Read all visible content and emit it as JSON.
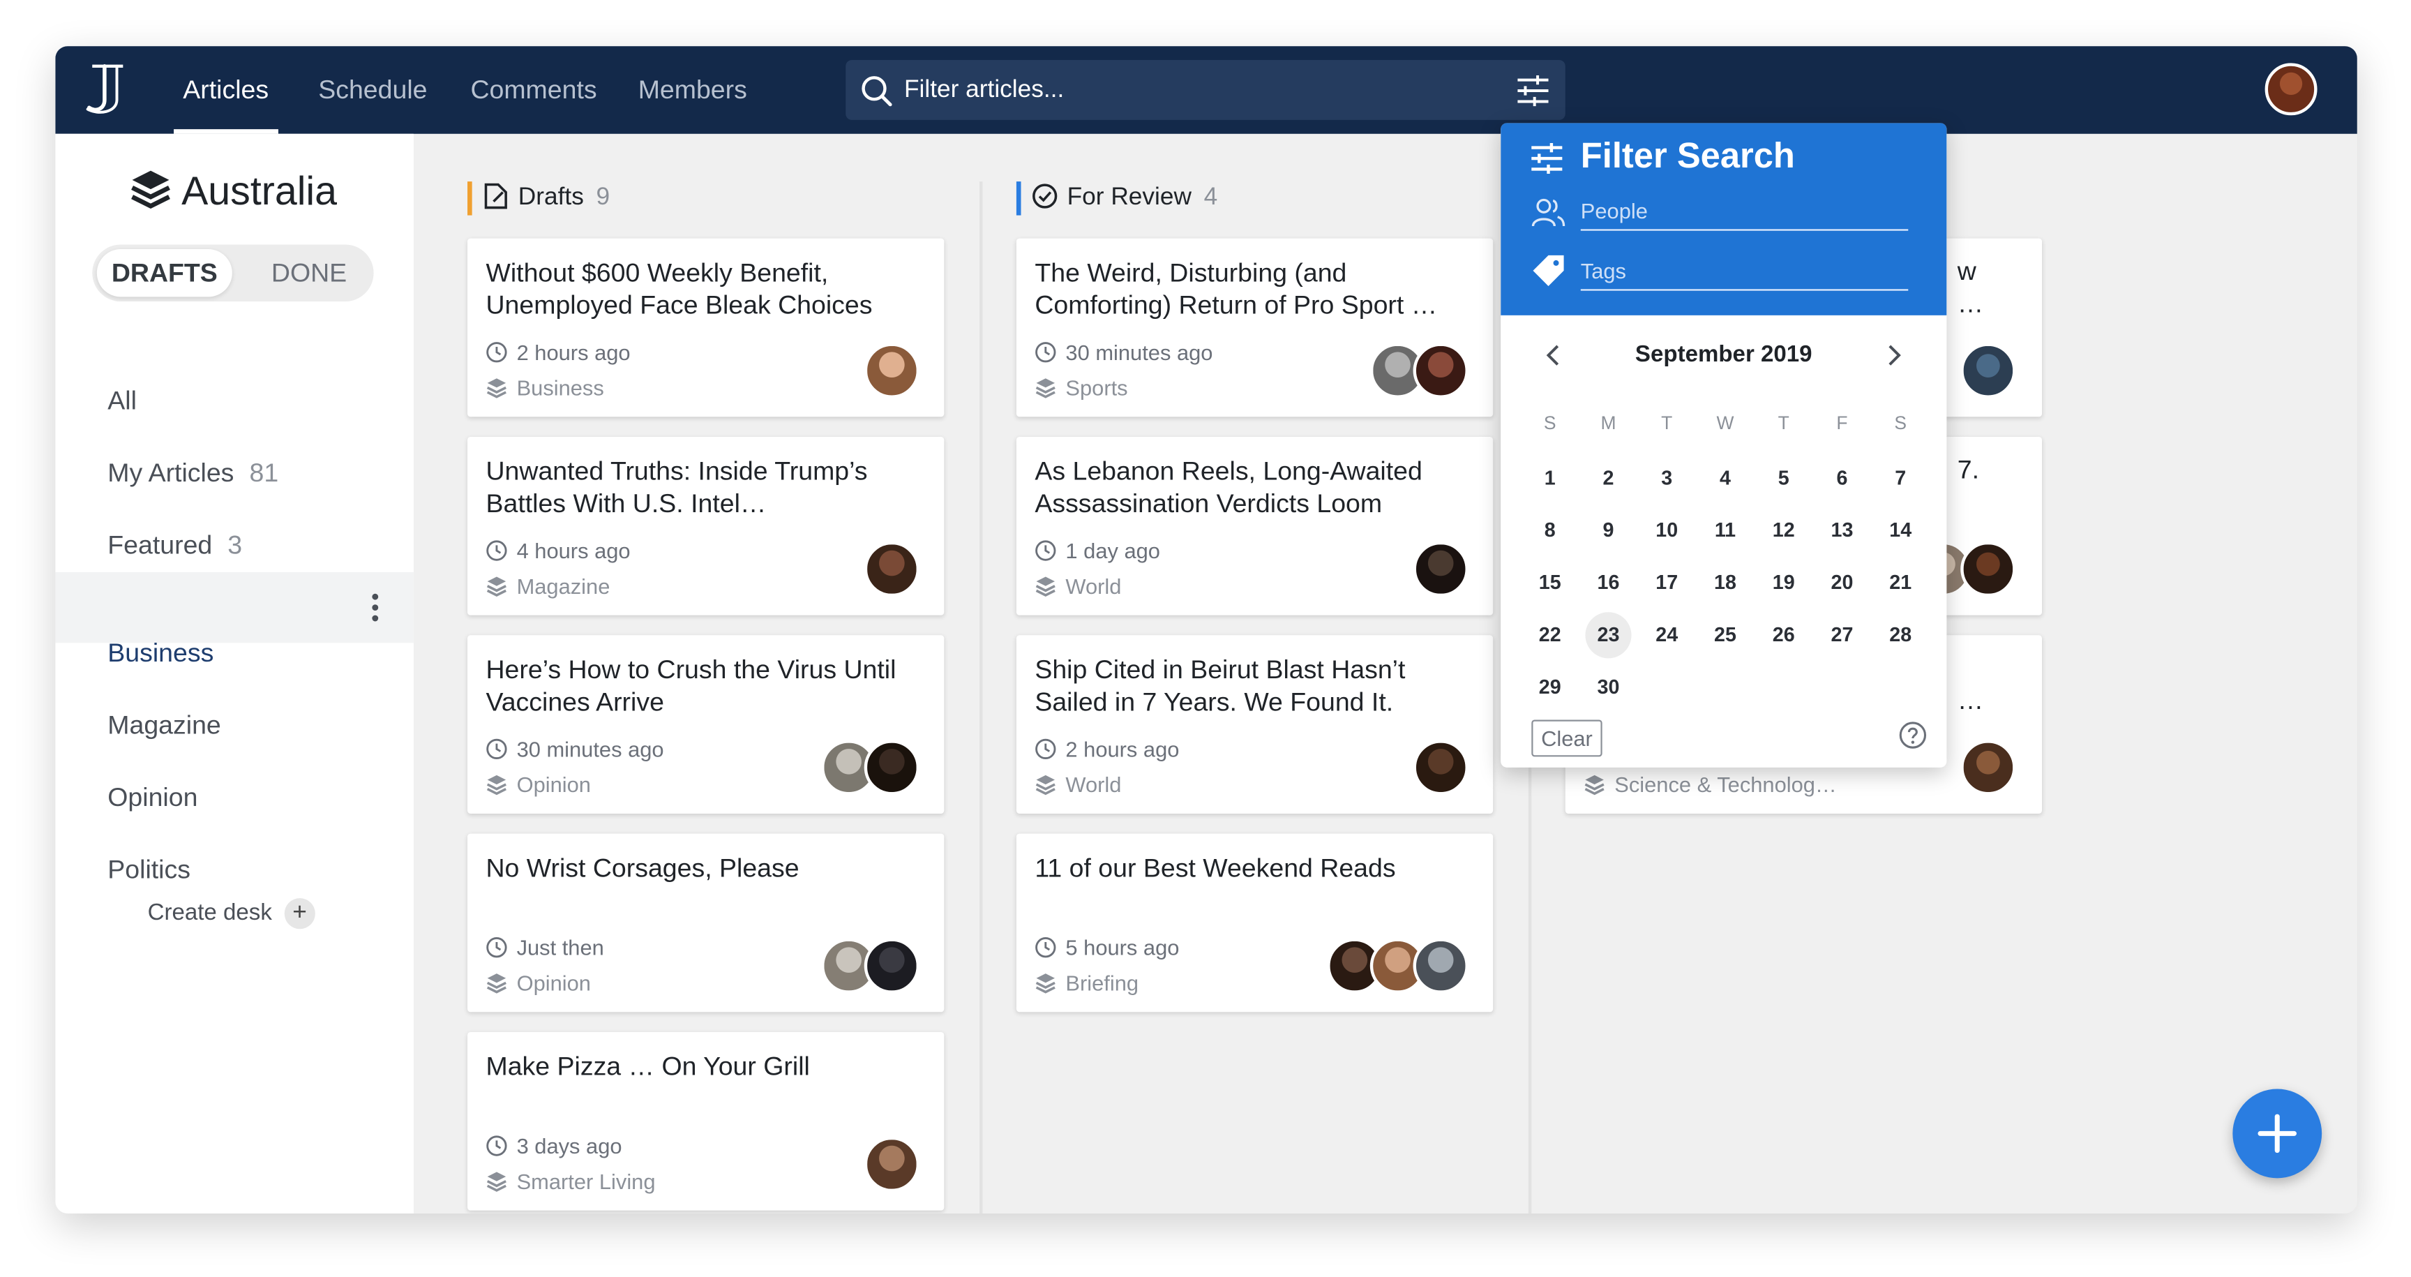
{
  "nav": {
    "articles": "Articles",
    "schedule": "Schedule",
    "comments": "Comments",
    "members": "Members"
  },
  "search": {
    "placeholder": "Filter articles..."
  },
  "sidebar": {
    "desk_title": "Australia",
    "seg_drafts": "DRAFTS",
    "seg_done": "DONE",
    "items": [
      {
        "label": "All",
        "count": ""
      },
      {
        "label": "My Articles",
        "count": "81"
      },
      {
        "label": "Featured",
        "count": "3"
      }
    ],
    "desks": [
      "Business",
      "Magazine",
      "Opinion",
      "Politics"
    ],
    "create_desk": "Create desk"
  },
  "columns": [
    {
      "title": "Drafts",
      "count": "9",
      "color": "#f0a030",
      "cards": [
        {
          "title": "Without $600 Weekly Benefit, Unemployed Face Bleak Choices",
          "time": "2 hours ago",
          "section": "Business"
        },
        {
          "title": "Unwanted Truths: Inside Trump’s Battles With U.S. Intel…",
          "time": "4 hours ago",
          "section": "Magazine"
        },
        {
          "title": "Here’s How to Crush the Virus Until Vaccines Arrive",
          "time": "30 minutes ago",
          "section": "Opinion"
        },
        {
          "title": "No Wrist Corsages, Please",
          "time": "Just then",
          "section": "Opinion"
        },
        {
          "title": "Make Pizza … On Your Grill",
          "time": "3 days ago",
          "section": "Smarter Living"
        }
      ]
    },
    {
      "title": "For Review",
      "count": "4",
      "color": "#2a7de1",
      "cards": [
        {
          "title": "The Weird, Disturbing (and Comforting) Return of Pro Sport …",
          "time": "30 minutes ago",
          "section": "Sports"
        },
        {
          "title": "As Lebanon Reels, Long-Awaited Asssassination Verdicts Loom",
          "time": "1 day ago",
          "section": "World"
        },
        {
          "title": "Ship Cited in Beirut Blast Hasn’t Sailed in 7 Years. We Found It.",
          "time": "2 hours ago",
          "section": "World"
        },
        {
          "title": "11 of our Best Weekend Reads",
          "time": "5 hours ago",
          "section": "Briefing"
        }
      ]
    },
    {
      "cards": [
        {
          "title_fragment_1": "w",
          "title_fragment_2": "…"
        },
        {
          "title_fragment_1": "7."
        },
        {
          "title_fragment_1": "…",
          "section": "Science & Technolog…"
        }
      ]
    }
  ],
  "filter": {
    "title": "Filter Search",
    "people_placeholder": "People",
    "tags_placeholder": "Tags",
    "month": "September 2019",
    "dow": [
      "S",
      "M",
      "T",
      "W",
      "T",
      "F",
      "S"
    ],
    "selected_day": 23,
    "clear": "Clear"
  },
  "colors": {
    "topbar": "#13294a",
    "accent": "#1f74d4",
    "fab": "#2a7de1"
  }
}
